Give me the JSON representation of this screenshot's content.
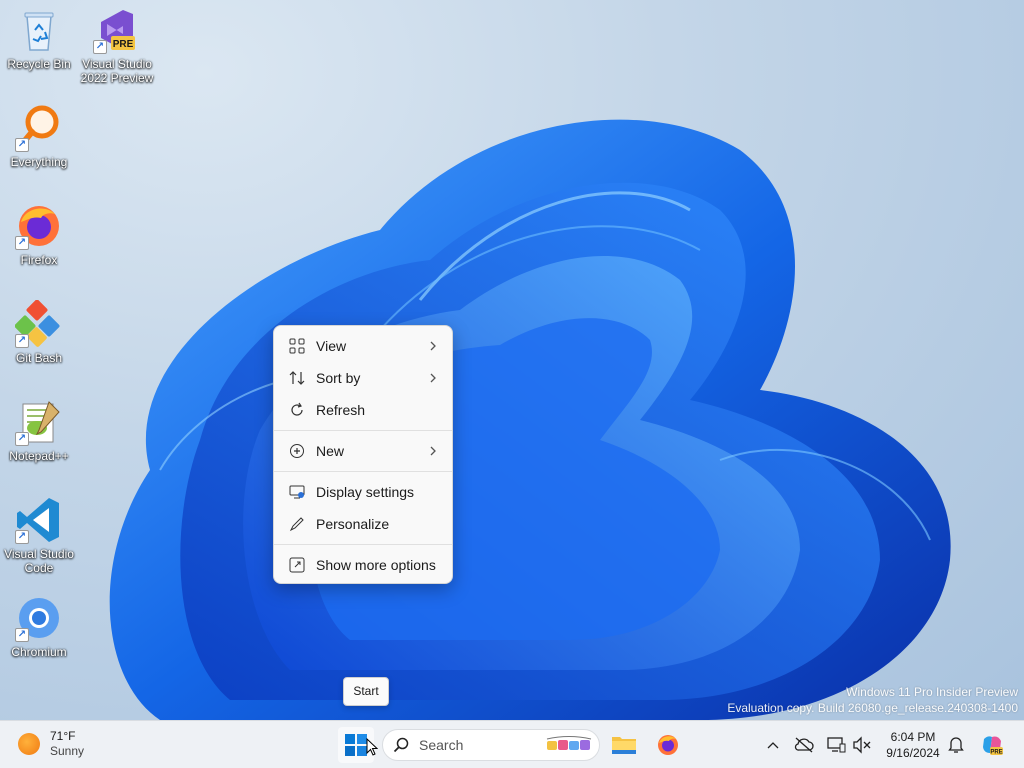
{
  "desktop": {
    "icons": [
      {
        "label": "Recycle Bin",
        "icon": "recycle-bin-icon"
      },
      {
        "label": "Visual Studio\n2022 Preview",
        "icon": "visual-studio-preview-icon",
        "badge": "PRE"
      },
      {
        "label": "Everything",
        "icon": "everything-search-icon"
      },
      {
        "label": "Firefox",
        "icon": "firefox-icon"
      },
      {
        "label": "Git Bash",
        "icon": "git-bash-icon"
      },
      {
        "label": "Notepad++",
        "icon": "notepad-plus-plus-icon"
      },
      {
        "label": "Visual Studio\nCode",
        "icon": "vscode-icon"
      },
      {
        "label": "Chromium",
        "icon": "chromium-icon"
      }
    ],
    "shortcut_glyph": "↗"
  },
  "context_menu": {
    "items": [
      {
        "label": "View",
        "icon": "view-grid-icon",
        "submenu": true
      },
      {
        "label": "Sort by",
        "icon": "sort-icon",
        "submenu": true
      },
      {
        "label": "Refresh",
        "icon": "refresh-icon",
        "submenu": false
      },
      {
        "label": "New",
        "icon": "new-plus-icon",
        "submenu": true
      },
      {
        "label": "Display settings",
        "icon": "display-settings-icon",
        "submenu": false
      },
      {
        "label": "Personalize",
        "icon": "pen-icon",
        "submenu": false
      },
      {
        "label": "Show more options",
        "icon": "show-more-icon",
        "submenu": false
      }
    ]
  },
  "tooltip": {
    "text": "Start"
  },
  "watermark": {
    "line1": "Windows 11 Pro Insider Preview",
    "line2": "Evaluation copy. Build 26080.ge_release.240308-1400"
  },
  "taskbar": {
    "weather": {
      "temp": "71°F",
      "condition": "Sunny"
    },
    "search_placeholder": "Search",
    "clock": {
      "time": "6:04 PM",
      "date": "9/16/2024"
    },
    "colors": {
      "accent": "#0067c0",
      "taskbar_bg": "#eef1f5"
    }
  }
}
